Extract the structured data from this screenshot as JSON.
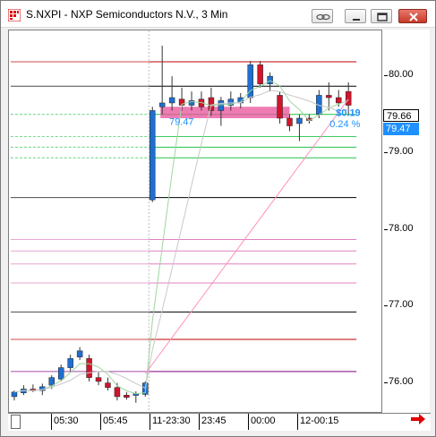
{
  "window": {
    "title": "S.NXPI - NXP Semiconductors N.V., 3 Min",
    "icon": "chart-grid-icon",
    "controls": [
      "link-icon",
      "minimize-icon",
      "maximize-icon",
      "close-icon"
    ]
  },
  "chart_data": {
    "type": "candlestick",
    "symbol": "S.NXPI",
    "interval": "3 Min",
    "price_axis": {
      "ticks": [
        "80.00",
        "79.00",
        "78.00",
        "77.00",
        "76.00"
      ],
      "ylim": [
        75.6,
        80.6
      ]
    },
    "time_axis": {
      "ticks": [
        "05:30",
        "05:45",
        "11-23:30",
        "23:45",
        "00:00",
        "12-00:15"
      ]
    },
    "current_price_label": "79.66",
    "current_price_color": "#ffffff",
    "last_price_label": "79.47",
    "last_price_color": "#1e90ff",
    "overlay_labels": {
      "left_price": "79.47",
      "change": "$0.19",
      "change_pct": "0.24 %"
    },
    "colors": {
      "up": "#1f6fcf",
      "down": "#d0152c",
      "highlight": "#e8509a",
      "green_line": "#23c24a",
      "purple_line": "#800080",
      "red_line": "#c00000",
      "pink_line": "#ff8fc0"
    },
    "horizontal_levels": [
      {
        "price": 80.62,
        "color": "#800080"
      },
      {
        "price": 80.19,
        "color": "#c00000"
      },
      {
        "price": 79.87,
        "color": "#000000"
      },
      {
        "price": 79.5,
        "color": "#23c24a"
      },
      {
        "price": 79.21,
        "color": "#23c24a"
      },
      {
        "price": 79.07,
        "color": "#23c24a"
      },
      {
        "price": 78.93,
        "color": "#23c24a"
      },
      {
        "price": 78.41,
        "color": "#000000"
      },
      {
        "price": 77.86,
        "color": "#e080c0"
      },
      {
        "price": 77.71,
        "color": "#e080c0"
      },
      {
        "price": 77.54,
        "color": "#e080c0"
      },
      {
        "price": 77.29,
        "color": "#e080c0"
      },
      {
        "price": 76.91,
        "color": "#000000"
      },
      {
        "price": 76.55,
        "color": "#c00000"
      },
      {
        "price": 76.13,
        "color": "#800080"
      }
    ],
    "candles": [
      {
        "o": 75.8,
        "h": 75.88,
        "l": 75.75,
        "c": 75.86
      },
      {
        "o": 75.85,
        "h": 75.95,
        "l": 75.82,
        "c": 75.9
      },
      {
        "o": 75.9,
        "h": 75.96,
        "l": 75.86,
        "c": 75.88
      },
      {
        "o": 75.88,
        "h": 75.97,
        "l": 75.82,
        "c": 75.93
      },
      {
        "o": 75.95,
        "h": 76.08,
        "l": 75.9,
        "c": 76.05
      },
      {
        "o": 76.03,
        "h": 76.22,
        "l": 76.0,
        "c": 76.18
      },
      {
        "o": 76.18,
        "h": 76.35,
        "l": 76.13,
        "c": 76.3
      },
      {
        "o": 76.32,
        "h": 76.45,
        "l": 76.28,
        "c": 76.4
      },
      {
        "o": 76.3,
        "h": 76.35,
        "l": 76.0,
        "c": 76.05
      },
      {
        "o": 76.05,
        "h": 76.12,
        "l": 75.95,
        "c": 76.0
      },
      {
        "o": 75.98,
        "h": 76.05,
        "l": 75.88,
        "c": 75.92
      },
      {
        "o": 75.92,
        "h": 75.98,
        "l": 75.75,
        "c": 75.8
      },
      {
        "o": 75.82,
        "h": 75.86,
        "l": 75.76,
        "c": 75.79
      },
      {
        "o": 75.82,
        "h": 75.87,
        "l": 75.72,
        "c": 75.84
      },
      {
        "o": 75.83,
        "h": 76.0,
        "l": 75.8,
        "c": 75.98
      },
      {
        "o": 78.38,
        "h": 79.6,
        "l": 78.35,
        "c": 79.55
      },
      {
        "o": 79.6,
        "h": 80.4,
        "l": 79.5,
        "c": 79.65
      },
      {
        "o": 79.65,
        "h": 80.0,
        "l": 79.55,
        "c": 79.72
      },
      {
        "o": 79.7,
        "h": 79.85,
        "l": 79.55,
        "c": 79.62
      },
      {
        "o": 79.62,
        "h": 79.8,
        "l": 79.55,
        "c": 79.68
      },
      {
        "o": 79.7,
        "h": 79.8,
        "l": 79.55,
        "c": 79.6
      },
      {
        "o": 79.72,
        "h": 79.85,
        "l": 79.48,
        "c": 79.55
      },
      {
        "o": 79.55,
        "h": 79.73,
        "l": 79.35,
        "c": 79.68
      },
      {
        "o": 79.62,
        "h": 79.8,
        "l": 79.55,
        "c": 79.7
      },
      {
        "o": 79.65,
        "h": 79.78,
        "l": 79.58,
        "c": 79.72
      },
      {
        "o": 79.72,
        "h": 80.2,
        "l": 79.65,
        "c": 80.15
      },
      {
        "o": 80.15,
        "h": 80.2,
        "l": 79.85,
        "c": 79.9
      },
      {
        "o": 79.9,
        "h": 80.05,
        "l": 79.8,
        "c": 80.0
      },
      {
        "o": 79.75,
        "h": 79.8,
        "l": 79.38,
        "c": 79.45
      },
      {
        "o": 79.45,
        "h": 79.5,
        "l": 79.28,
        "c": 79.35
      },
      {
        "o": 79.38,
        "h": 79.5,
        "l": 79.15,
        "c": 79.45
      },
      {
        "o": 79.45,
        "h": 79.5,
        "l": 79.38,
        "c": 79.42
      },
      {
        "o": 79.5,
        "h": 79.82,
        "l": 79.45,
        "c": 79.75
      },
      {
        "o": 79.75,
        "h": 79.92,
        "l": 79.55,
        "c": 79.72
      },
      {
        "o": 79.72,
        "h": 79.82,
        "l": 79.6,
        "c": 79.65
      },
      {
        "o": 79.8,
        "h": 79.92,
        "l": 79.5,
        "c": 79.62
      }
    ]
  },
  "navigation": {
    "right_arrow": "arrow-right-icon"
  }
}
